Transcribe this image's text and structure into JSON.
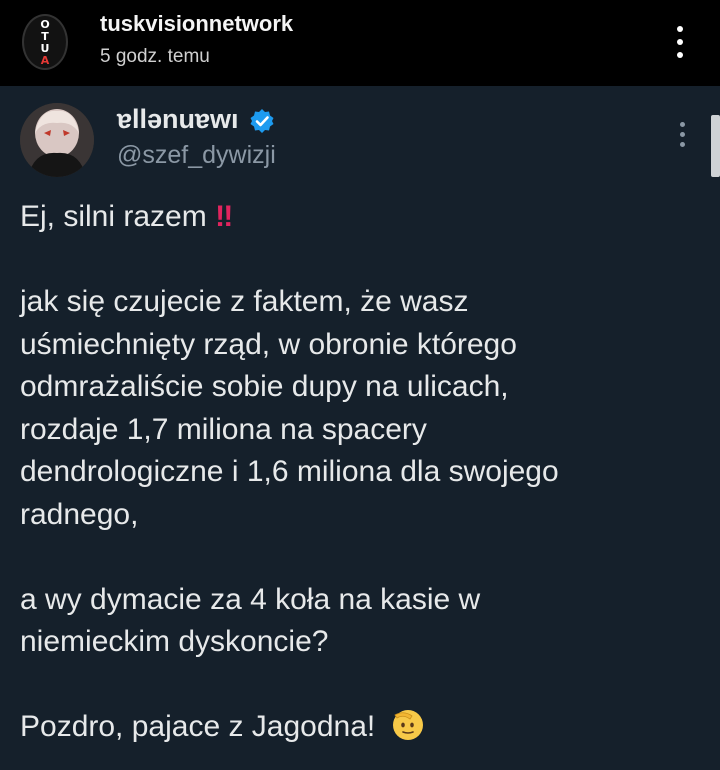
{
  "header": {
    "avatar_letters": [
      "O",
      "T",
      "U",
      "A"
    ],
    "username": "tuskvisionnetwork",
    "time": "5 godz. temu"
  },
  "tweet": {
    "display_name": "ɐllənuɐwı",
    "handle": "@szef_dywizji",
    "verified": true,
    "line1_text": "Ej, silni razem",
    "line1_emoji": "‼",
    "paragraph2": [
      "jak się czujecie z faktem, że wasz",
      "uśmiechnięty rząd, w obronie którego",
      "odmrażaliście sobie dupy na ulicach,",
      "rozdaje 1,7 miliona na spacery",
      "dendrologiczne i 1,6 miliona dla swojego",
      "radnego,"
    ],
    "paragraph3": [
      "a wy dymacie za 4 koła na kasie w",
      "niemieckim dyskoncie?"
    ],
    "closing_text": "Pozdro, pajace z Jagodna!",
    "closing_emoji": "saluting-face"
  },
  "colors": {
    "background": "#15202b",
    "header_background": "#000000",
    "verified_blue": "#1d9bf0",
    "emoji_red": "#e0245e"
  }
}
